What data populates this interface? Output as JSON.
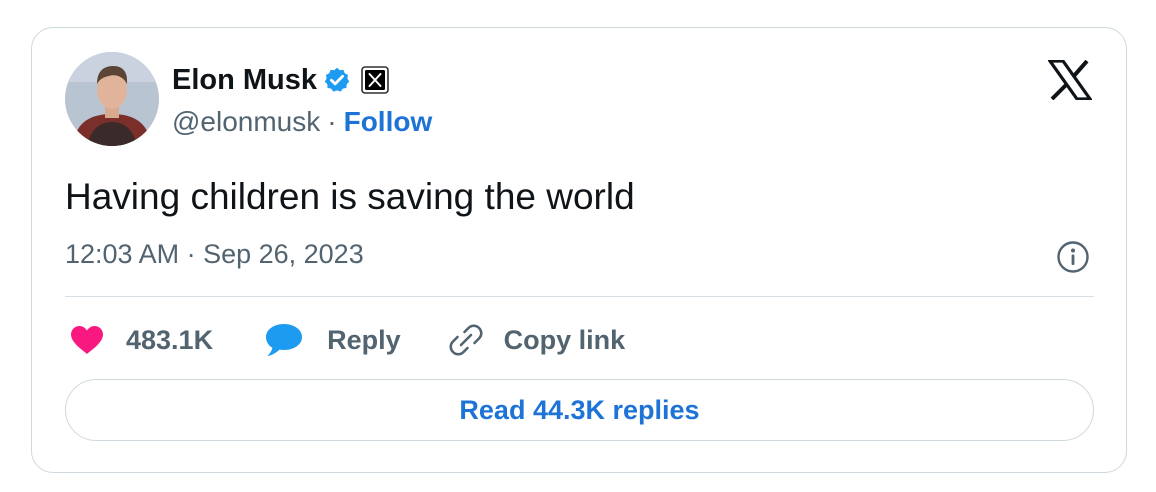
{
  "author": {
    "name": "Elon Musk",
    "handle": "@elonmusk",
    "separator": "·",
    "follow_label": "Follow",
    "avatar_icon": "profile-photo"
  },
  "tweet": {
    "text": "Having children is saving the world",
    "timestamp": "12:03 AM · Sep 26, 2023"
  },
  "actions": {
    "likes_count": "483.1K",
    "reply_label": "Reply",
    "copy_link_label": "Copy link"
  },
  "read_replies_label": "Read 44.3K replies",
  "icons": {
    "verified": "verified-badge-icon",
    "org_badge": "x-badge-icon",
    "brand": "x-logo-icon",
    "info": "info-icon",
    "like": "heart-icon",
    "reply": "speech-bubble-icon",
    "copy": "link-icon"
  },
  "colors": {
    "text": "#0f1419",
    "secondary": "#536471",
    "link": "#1d73d6",
    "like": "#f91880",
    "reply": "#1d9bf0",
    "border": "#cfd9de",
    "verified": "#1d9bf0"
  }
}
